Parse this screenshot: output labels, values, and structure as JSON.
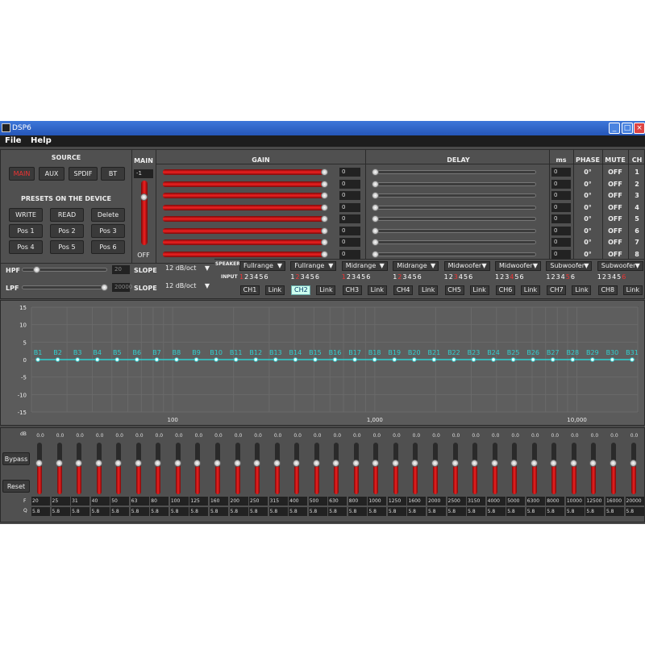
{
  "window": {
    "title": "DSP6"
  },
  "menu": [
    {
      "label": "File"
    },
    {
      "label": "Help"
    }
  ],
  "source": {
    "header": "SOURCE",
    "buttons": [
      {
        "label": "MAIN"
      },
      {
        "label": "AUX"
      },
      {
        "label": "SPDIF"
      },
      {
        "label": "BT"
      }
    ],
    "selected": "MAIN"
  },
  "presets": {
    "header": "PRESETS ON THE DEVICE",
    "actions": [
      {
        "label": "WRITE"
      },
      {
        "label": "READ"
      },
      {
        "label": "Delete"
      }
    ],
    "positions": [
      {
        "label": "Pos 1"
      },
      {
        "label": "Pos 2"
      },
      {
        "label": "Pos 3"
      },
      {
        "label": "Pos 4"
      },
      {
        "label": "Pos 5"
      },
      {
        "label": "Pos 6"
      }
    ]
  },
  "filters": {
    "hpf": {
      "label": "HPF",
      "value": "20",
      "slope_label": "SLOPE",
      "slope": "12 dB/oct"
    },
    "lpf": {
      "label": "LPF",
      "value": "20000",
      "slope_label": "SLOPE",
      "slope": "12 dB/oct"
    }
  },
  "main": {
    "header": "MAIN",
    "value": "-1",
    "off_label": "OFF"
  },
  "headers": {
    "gain": "GAIN",
    "delay": "DELAY",
    "ms": "ms",
    "phase": "PHASE",
    "mute": "MUTE",
    "ch": "CH"
  },
  "channels": [
    {
      "ch": "1",
      "gain": "0",
      "ms": "0",
      "phase": "0°",
      "mute": "OFF",
      "gain_level": 1.0,
      "delay_level": 0.0
    },
    {
      "ch": "2",
      "gain": "0",
      "ms": "0",
      "phase": "0°",
      "mute": "OFF",
      "gain_level": 1.0,
      "delay_level": 0.0
    },
    {
      "ch": "3",
      "gain": "0",
      "ms": "0",
      "phase": "0°",
      "mute": "OFF",
      "gain_level": 1.0,
      "delay_level": 0.0
    },
    {
      "ch": "4",
      "gain": "0",
      "ms": "0",
      "phase": "0°",
      "mute": "OFF",
      "gain_level": 1.0,
      "delay_level": 0.0
    },
    {
      "ch": "5",
      "gain": "0",
      "ms": "0",
      "phase": "0°",
      "mute": "OFF",
      "gain_level": 1.0,
      "delay_level": 0.0
    },
    {
      "ch": "6",
      "gain": "0",
      "ms": "0",
      "phase": "0°",
      "mute": "OFF",
      "gain_level": 1.0,
      "delay_level": 0.0
    },
    {
      "ch": "7",
      "gain": "0",
      "ms": "0",
      "phase": "0°",
      "mute": "OFF",
      "gain_level": 1.0,
      "delay_level": 0.0
    },
    {
      "ch": "8",
      "gain": "0",
      "ms": "0",
      "phase": "0°",
      "mute": "OFF",
      "gain_level": 1.0,
      "delay_level": 0.0
    }
  ],
  "routing": {
    "speaker_label": "SPEAKER",
    "input_label": "INPUT",
    "link_label": "Link",
    "input_digits": [
      "1",
      "2",
      "3",
      "4",
      "5",
      "6"
    ],
    "outputs": [
      {
        "speaker": "Fullrange",
        "channel": "CH1",
        "active_input": 1,
        "selected": false
      },
      {
        "speaker": "Fullrange",
        "channel": "CH2",
        "active_input": 2,
        "selected": true
      },
      {
        "speaker": "Midrange",
        "channel": "CH3",
        "active_input": 1,
        "selected": false
      },
      {
        "speaker": "Midrange",
        "channel": "CH4",
        "active_input": 2,
        "selected": false
      },
      {
        "speaker": "Midwoofer",
        "channel": "CH5",
        "active_input": 3,
        "selected": false
      },
      {
        "speaker": "Midwoofer",
        "channel": "CH6",
        "active_input": 4,
        "selected": false
      },
      {
        "speaker": "Subwoofer",
        "channel": "CH7",
        "active_input": 5,
        "selected": false
      },
      {
        "speaker": "Subwoofer",
        "channel": "CH8",
        "active_input": 6,
        "selected": false
      }
    ]
  },
  "graph": {
    "y_ticks": [
      "15",
      "10",
      "5",
      "0",
      "-5",
      "-10",
      "-15"
    ],
    "x_ticks": [
      "100",
      "1,000",
      "10,000"
    ],
    "bands": [
      "B1",
      "B2",
      "B3",
      "B4",
      "B5",
      "B6",
      "B7",
      "B8",
      "B9",
      "B10",
      "B11",
      "B12",
      "B13",
      "B14",
      "B15",
      "B16",
      "B17",
      "B18",
      "B19",
      "B20",
      "B21",
      "B22",
      "B23",
      "B24",
      "B25",
      "B26",
      "B27",
      "B28",
      "B29",
      "B30",
      "B31"
    ],
    "colors": {
      "line": "#2fd0d0",
      "grid": "#6a6a6a"
    }
  },
  "eq": {
    "db_label": "dB",
    "f_label": "F",
    "q_label": "Q",
    "bypass_label": "Bypass",
    "reset_label": "Reset",
    "bands": [
      {
        "db": "0.0",
        "f": "20",
        "q": "5.8"
      },
      {
        "db": "0.0",
        "f": "25",
        "q": "5.8"
      },
      {
        "db": "0.0",
        "f": "31",
        "q": "5.8"
      },
      {
        "db": "0.0",
        "f": "40",
        "q": "5.8"
      },
      {
        "db": "0.0",
        "f": "50",
        "q": "5.8"
      },
      {
        "db": "0.0",
        "f": "63",
        "q": "5.8"
      },
      {
        "db": "0.0",
        "f": "80",
        "q": "5.8"
      },
      {
        "db": "0.0",
        "f": "100",
        "q": "5.8"
      },
      {
        "db": "0.0",
        "f": "125",
        "q": "5.8"
      },
      {
        "db": "0.0",
        "f": "160",
        "q": "5.8"
      },
      {
        "db": "0.0",
        "f": "200",
        "q": "5.8"
      },
      {
        "db": "0.0",
        "f": "250",
        "q": "5.8"
      },
      {
        "db": "0.0",
        "f": "315",
        "q": "5.8"
      },
      {
        "db": "0.0",
        "f": "400",
        "q": "5.8"
      },
      {
        "db": "0.0",
        "f": "500",
        "q": "5.8"
      },
      {
        "db": "0.0",
        "f": "630",
        "q": "5.8"
      },
      {
        "db": "0.0",
        "f": "800",
        "q": "5.8"
      },
      {
        "db": "0.0",
        "f": "1000",
        "q": "5.8"
      },
      {
        "db": "0.0",
        "f": "1250",
        "q": "5.8"
      },
      {
        "db": "0.0",
        "f": "1600",
        "q": "5.8"
      },
      {
        "db": "0.0",
        "f": "2000",
        "q": "5.8"
      },
      {
        "db": "0.0",
        "f": "2500",
        "q": "5.8"
      },
      {
        "db": "0.0",
        "f": "3150",
        "q": "5.8"
      },
      {
        "db": "0.0",
        "f": "4000",
        "q": "5.8"
      },
      {
        "db": "0.0",
        "f": "5000",
        "q": "5.8"
      },
      {
        "db": "0.0",
        "f": "6300",
        "q": "5.8"
      },
      {
        "db": "0.0",
        "f": "8000",
        "q": "5.8"
      },
      {
        "db": "0.0",
        "f": "10000",
        "q": "5.8"
      },
      {
        "db": "0.0",
        "f": "12500",
        "q": "5.8"
      },
      {
        "db": "0.0",
        "f": "16000",
        "q": "5.8"
      },
      {
        "db": "0.0",
        "f": "20000",
        "q": "5.8"
      }
    ]
  }
}
